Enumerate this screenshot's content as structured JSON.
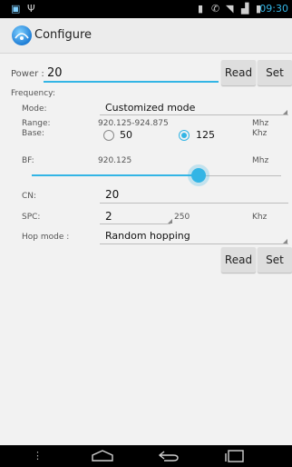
{
  "status_bar": {
    "time": "09:30"
  },
  "app": {
    "title": "Configure"
  },
  "power": {
    "label": "Power :",
    "value": "20",
    "read_label": "Read",
    "set_label": "Set"
  },
  "frequency": {
    "label": "Frequency:",
    "mode": {
      "label": "Mode:",
      "value": "Customized mode"
    },
    "range": {
      "label": "Range:",
      "value": "920.125-924.875",
      "unit": "Mhz"
    },
    "base": {
      "label": "Base:",
      "options": [
        "50",
        "125"
      ],
      "selected": "125",
      "unit": "Khz"
    },
    "bf": {
      "label": "BF:",
      "value": "920.125",
      "unit": "Mhz",
      "slider_fraction": 0.67
    },
    "cn": {
      "label": "CN:",
      "value": "20"
    },
    "spc": {
      "label": "SPC:",
      "value": "2",
      "max_hint": "250",
      "unit": "Khz"
    },
    "hop_mode": {
      "label": "Hop mode :",
      "value": "Random hopping"
    },
    "read_label": "Read",
    "set_label": "Set"
  }
}
